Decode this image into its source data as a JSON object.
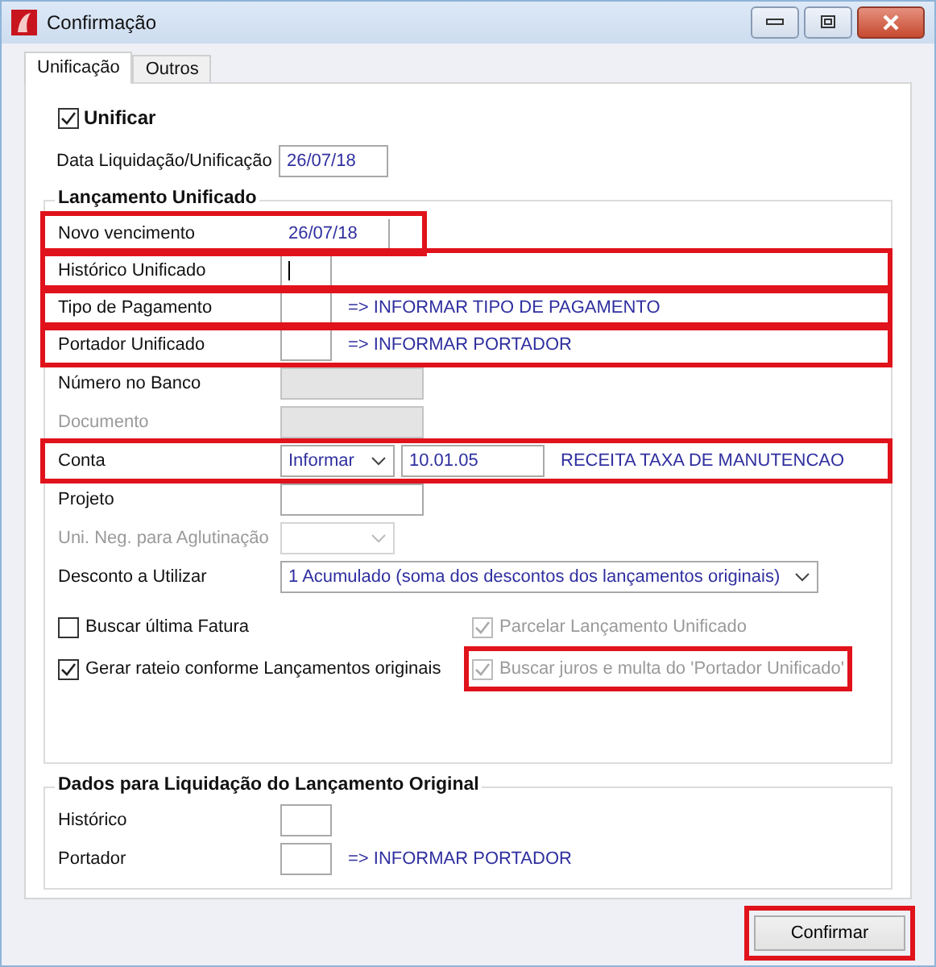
{
  "window": {
    "title": "Confirmação"
  },
  "tabs": [
    {
      "label": "Unificação",
      "selected": true
    },
    {
      "label": "Outros",
      "selected": false
    }
  ],
  "unificar": {
    "label": "Unificar",
    "checked": true
  },
  "data_liquidacao": {
    "label": "Data Liquidação/Unificação",
    "value": "26/07/18"
  },
  "group_unificado": {
    "title": "Lançamento Unificado",
    "rows": [
      {
        "kind": "date",
        "label": "Novo vencimento",
        "value": "26/07/18",
        "disabled": false,
        "highlighted": true
      },
      {
        "kind": "code",
        "label": "Histórico Unificado",
        "disabled": false,
        "readonly": false,
        "focused": true,
        "highlighted": true
      },
      {
        "kind": "code",
        "label": "Tipo de Pagamento",
        "note": "=> INFORMAR TIPO DE PAGAMENTO",
        "disabled": false,
        "readonly": false,
        "focused": false,
        "highlighted": true
      },
      {
        "kind": "code",
        "label": "Portador Unificado",
        "note": "=> INFORMAR PORTADOR",
        "disabled": false,
        "readonly": false,
        "focused": false,
        "highlighted": true
      },
      {
        "kind": "text",
        "label": "Número no Banco",
        "disabled": false,
        "readonly": true,
        "focused": false,
        "highlighted": false
      },
      {
        "kind": "text",
        "label": "Documento",
        "disabled": true,
        "readonly": true,
        "focused": false,
        "highlighted": false
      },
      {
        "kind": "account",
        "label": "Conta",
        "option": "Informar",
        "value": "10.01.05",
        "note": "RECEITA TAXA DE MANUTENCAO",
        "disabled": false,
        "highlighted": true
      },
      {
        "kind": "text",
        "label": "Projeto",
        "disabled": false,
        "readonly": false,
        "focused": false,
        "highlighted": false
      },
      {
        "kind": "select",
        "label": "Uni. Neg. para Aglutinação",
        "disabled": true,
        "highlighted": false
      },
      {
        "kind": "wideselect",
        "label": "Desconto a Utilizar",
        "value": "1 Acumulado (soma dos descontos dos lançamentos originais)",
        "disabled": false,
        "highlighted": false
      }
    ],
    "options": [
      {
        "label": "Buscar última Fatura",
        "checked": false,
        "disabled": false,
        "highlight": false
      },
      {
        "label": "Parcelar Lançamento Unificado",
        "checked": true,
        "disabled": true,
        "highlight": false
      },
      {
        "label": "Gerar rateio conforme Lançamentos originais",
        "checked": true,
        "disabled": false,
        "highlight": false
      },
      {
        "label": "Buscar juros e multa do 'Portador Unificado'",
        "checked": true,
        "disabled": true,
        "highlight": true
      }
    ]
  },
  "group_original": {
    "title": "Dados para Liquidação do Lançamento Original",
    "rows": [
      {
        "kind": "code",
        "label": "Histórico",
        "disabled": false,
        "readonly": false,
        "focused": false,
        "highlighted": false
      },
      {
        "kind": "code",
        "label": "Portador",
        "note": "=> INFORMAR PORTADOR",
        "disabled": false,
        "readonly": false,
        "focused": false,
        "highlighted": false
      }
    ]
  },
  "confirm_button": {
    "label": "Confirmar",
    "highlight": true
  }
}
